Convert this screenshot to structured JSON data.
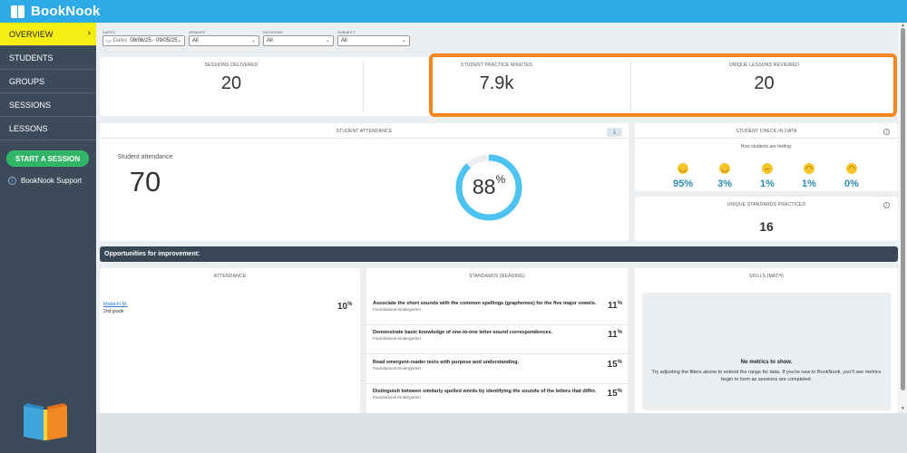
{
  "app": {
    "name": "BookNook"
  },
  "sidebar": {
    "items": [
      {
        "label": "OVERVIEW",
        "active": true
      },
      {
        "label": "STUDENTS"
      },
      {
        "label": "GROUPS"
      },
      {
        "label": "SESSIONS"
      },
      {
        "label": "LESSONS"
      }
    ],
    "start_session_label": "START A SESSION",
    "support_label": "BookNook Support"
  },
  "filters": {
    "dates": {
      "label": "DATES",
      "prefix": "Dates",
      "value": "08/06/25 - 09/05/25"
    },
    "grades": {
      "label": "GRADES",
      "value": "All"
    },
    "sessions": {
      "label": "SESSIONS",
      "value": "All"
    },
    "subject": {
      "label": "SUBJECT",
      "value": "All"
    }
  },
  "stats": {
    "sessions_delivered": {
      "label": "SESSIONS DELIVERED",
      "value": "20"
    },
    "practice_minutes": {
      "label": "STUDENT PRACTICE MINUTES",
      "value": "7.9k"
    },
    "unique_lessons": {
      "label": "UNIQUE LESSONS REVIEWED",
      "value": "20"
    }
  },
  "attendance": {
    "header": "STUDENT ATTENDANCE",
    "label": "Student attendance",
    "value": "70",
    "percent_value": 88,
    "percent": "88",
    "percent_sign": "%"
  },
  "checkin": {
    "header": "STUDENT CHECK-IN DATA",
    "question": "How students are feeling:",
    "values": [
      "95%",
      "3%",
      "1%",
      "1%",
      "0%"
    ]
  },
  "standards_practiced": {
    "label": "UNIQUE STANDARDS PRACTICED",
    "value": "16"
  },
  "opportunities": {
    "title": "Opportunities for improvement:",
    "attendance_header": "ATTENDANCE",
    "standards_header": "STANDARDS (READING)",
    "skills_header": "SKILLS (MATH)",
    "students": [
      {
        "name": "Malachi M.",
        "grade": "2nd grade",
        "pct": "10"
      }
    ],
    "standards": [
      {
        "title": "Associate the short sounds with the common spellings (graphemes) for the five major vowels.",
        "sub": "Foundational Kindergarten",
        "pct": "11"
      },
      {
        "title": "Demonstrate basic knowledge of one-to-one letter-sound correspondences.",
        "sub": "Foundational Kindergarten",
        "pct": "11"
      },
      {
        "title": "Read emergent-reader texts with purpose and understanding.",
        "sub": "Foundational Kindergarten",
        "pct": "15"
      },
      {
        "title": "Distinguish between similarly spelled words by identifying the sounds of the letters that differ.",
        "sub": "Foundational Kindergarten",
        "pct": "15"
      }
    ],
    "percent_sign": "%",
    "empty_title": "No metrics to show.",
    "empty_msg": "Try adjusting the filters above to extend the range for data. If you're new to BookNook, you'll see metrics begin to form as sessions are completed."
  },
  "colors": {
    "topbar": "#2eaae6",
    "sidebar": "#3d4a5a",
    "active_nav": "#f6ee12",
    "start_button": "#2fb565",
    "highlight": "#f4881f",
    "ring": "#4cc3f0",
    "percent_text": "#2b8eb0"
  }
}
